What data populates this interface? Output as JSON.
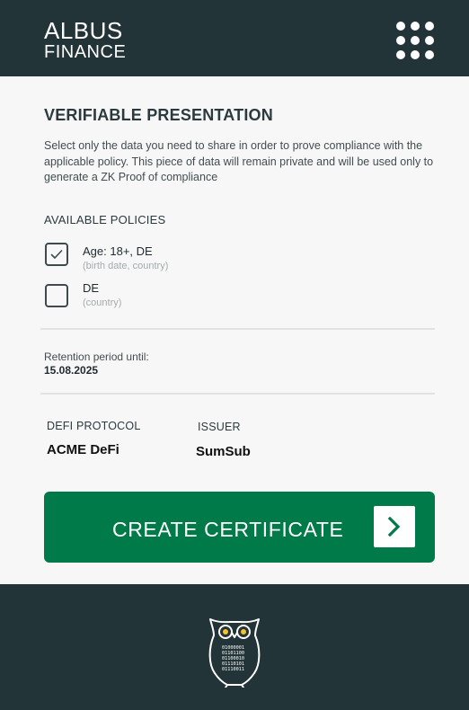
{
  "header": {
    "brand_line1": "ALBUS",
    "brand_line2": "FINANCE",
    "menu_icon": "grid-menu-icon"
  },
  "main": {
    "title": "VERIFIABLE PRESENTATION",
    "description": "Select only the data you need to share in order to prove compliance with the applicable policy. This piece of data will remain private and will be used only to generate a ZK Proof of compliance",
    "policies_heading": "AVAILABLE POLICIES",
    "policies": [
      {
        "name": "Age: 18+, DE",
        "details": "(birth date, country)",
        "checked": true
      },
      {
        "name": "DE",
        "details": "(country)",
        "checked": false
      }
    ],
    "retention_label": "Retention period until:",
    "retention_date": "15.08.2025",
    "defi_label": "DEFI PROTOCOL",
    "defi_value": "ACME DeFi",
    "issuer_label": "ISSUER",
    "issuer_value": "SumSub",
    "create_button_label": "CREATE CERTIFICATE"
  },
  "footer": {
    "logo_icon": "owl-logo-icon",
    "owl_code": [
      "01000001",
      "01101100",
      "01100010",
      "01110101",
      "01110011"
    ]
  },
  "colors": {
    "header_bg": "#233439",
    "content_bg": "#f7f7f7",
    "accent_green": "#017a49",
    "owl_eye": "#f4c430"
  }
}
